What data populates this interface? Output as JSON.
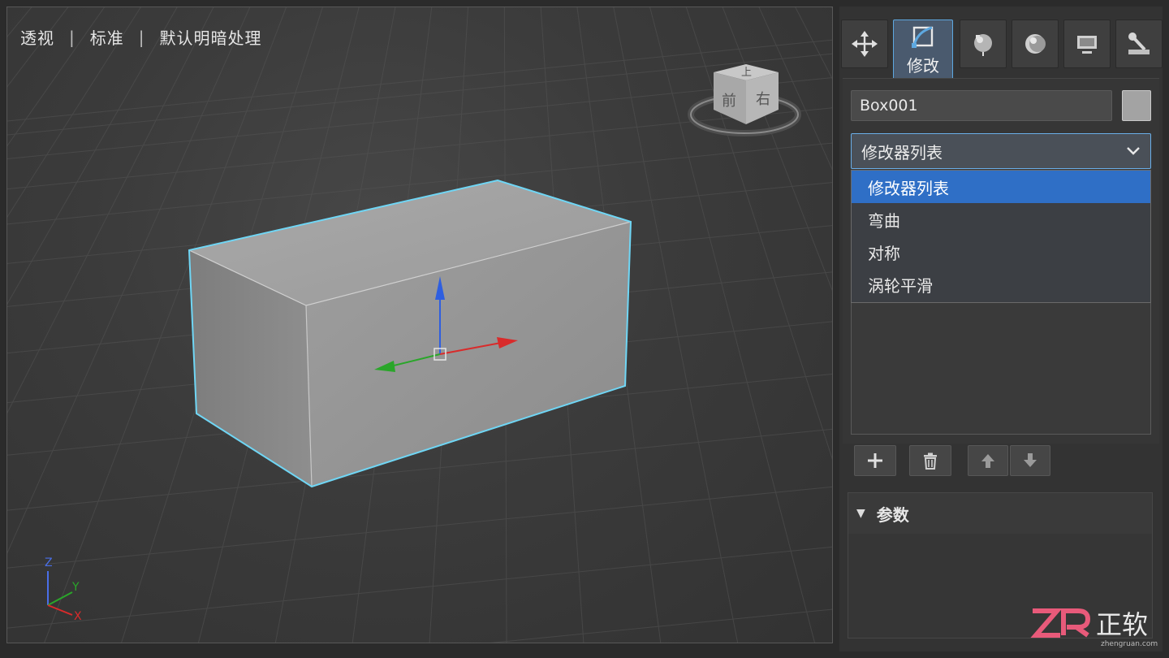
{
  "viewport": {
    "labels": [
      "透视",
      "标准",
      "默认明暗处理"
    ],
    "separator": "|",
    "viewcube": {
      "top": "上",
      "front": "前",
      "right": "右"
    },
    "axes": {
      "z": "Z",
      "y": "Y",
      "x": "X"
    }
  },
  "panel": {
    "tabs": [
      {
        "icon": "move-icon"
      },
      {
        "icon": "modify-icon",
        "label": "修改",
        "active": true
      },
      {
        "icon": "hierarchy-icon"
      },
      {
        "icon": "motion-icon"
      },
      {
        "icon": "display-icon"
      },
      {
        "icon": "utilities-icon"
      }
    ],
    "object_name": "Box001",
    "object_color": "#a3a3a3",
    "modifier_select": {
      "value": "修改器列表"
    },
    "modifier_options": [
      "修改器列表",
      "弯曲",
      "对称",
      "涡轮平滑"
    ],
    "selected_option_index": 0,
    "stack_buttons": [
      {
        "icon": "plus-icon"
      },
      {
        "icon": "trash-icon"
      },
      {
        "icon": "arrow-up-icon"
      },
      {
        "icon": "arrow-down-icon"
      }
    ],
    "params": {
      "title": "参数",
      "expanded": true
    }
  },
  "watermark": {
    "brand": "正软",
    "logo": "ZR",
    "url": "zhengruan.com"
  },
  "colors": {
    "accent": "#5ea8e0",
    "selection_outline": "#6fd6f5",
    "dropdown_highlight": "#2f6fc6",
    "gizmo_x": "#d92b2b",
    "gizmo_y": "#2aa62a",
    "gizmo_z": "#2f5fe0"
  }
}
